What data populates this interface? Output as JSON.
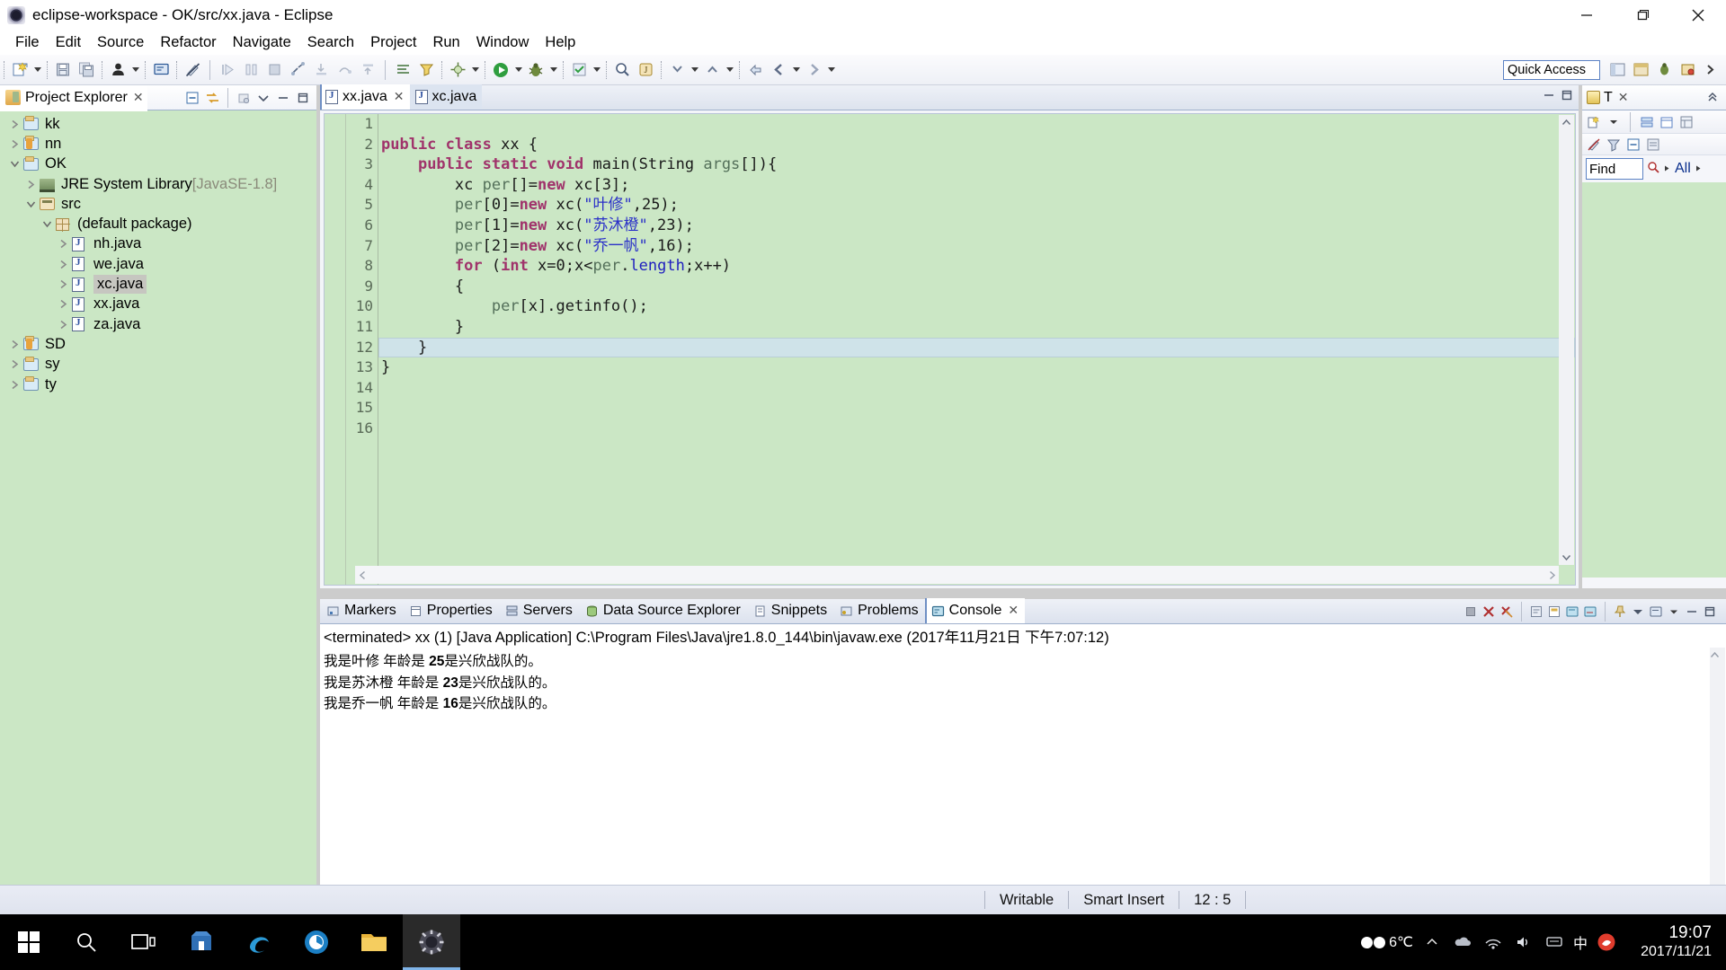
{
  "window": {
    "title": "eclipse-workspace - OK/src/xx.java - Eclipse",
    "app_icon": "eclipse-icon",
    "minimize_label": "minimize-icon",
    "maximize_label": "maximize-icon",
    "close_label": "close-icon"
  },
  "menubar": {
    "items": [
      {
        "label": "File"
      },
      {
        "label": "Edit"
      },
      {
        "label": "Source"
      },
      {
        "label": "Refactor"
      },
      {
        "label": "Navigate"
      },
      {
        "label": "Search"
      },
      {
        "label": "Project"
      },
      {
        "label": "Run"
      },
      {
        "label": "Window"
      },
      {
        "label": "Help"
      }
    ]
  },
  "toolbar": {
    "quick_access_value": "Quick Access",
    "quick_access_placeholder": "Quick Access"
  },
  "project_explorer": {
    "tab_label": "Project Explorer",
    "close_label": "✕",
    "tree": [
      {
        "label": "kk",
        "indent": 0,
        "twisty": "collapsed",
        "icon": "project-folder-icon",
        "dim": "",
        "selected": false
      },
      {
        "label": "nn",
        "indent": 0,
        "twisty": "collapsed",
        "icon": "project-warn-icon",
        "dim": "",
        "selected": false
      },
      {
        "label": "OK",
        "indent": 0,
        "twisty": "expanded",
        "icon": "project-folder-icon",
        "dim": "",
        "selected": false
      },
      {
        "label": "JRE System Library",
        "indent": 1,
        "twisty": "collapsed",
        "icon": "library-icon",
        "dim": " [JavaSE-1.8]",
        "selected": false
      },
      {
        "label": "src",
        "indent": 1,
        "twisty": "expanded",
        "icon": "source-folder-icon",
        "dim": "",
        "selected": false
      },
      {
        "label": "(default package)",
        "indent": 2,
        "twisty": "expanded",
        "icon": "package-icon",
        "dim": "",
        "selected": false
      },
      {
        "label": "nh.java",
        "indent": 3,
        "twisty": "collapsed",
        "icon": "java-file-icon",
        "dim": "",
        "selected": false
      },
      {
        "label": "we.java",
        "indent": 3,
        "twisty": "collapsed",
        "icon": "java-file-icon",
        "dim": "",
        "selected": false
      },
      {
        "label": "xc.java",
        "indent": 3,
        "twisty": "collapsed",
        "icon": "java-file-icon",
        "dim": "",
        "selected": true
      },
      {
        "label": "xx.java",
        "indent": 3,
        "twisty": "collapsed",
        "icon": "java-file-icon",
        "dim": "",
        "selected": false
      },
      {
        "label": "za.java",
        "indent": 3,
        "twisty": "collapsed",
        "icon": "java-file-icon",
        "dim": "",
        "selected": false
      },
      {
        "label": "SD",
        "indent": 0,
        "twisty": "collapsed",
        "icon": "project-warn-icon",
        "dim": "",
        "selected": false
      },
      {
        "label": "sy",
        "indent": 0,
        "twisty": "collapsed",
        "icon": "project-folder-icon",
        "dim": "",
        "selected": false
      },
      {
        "label": "ty",
        "indent": 0,
        "twisty": "collapsed",
        "icon": "project-folder-icon",
        "dim": "",
        "selected": false
      }
    ]
  },
  "editor": {
    "tabs": [
      {
        "label": "xx.java",
        "active": true,
        "close_label": "✕"
      },
      {
        "label": "xc.java",
        "active": false,
        "close_label": ""
      }
    ],
    "current_line": 12,
    "total_gutter_lines": 16,
    "line_numbers": [
      1,
      2,
      3,
      4,
      5,
      6,
      7,
      8,
      9,
      10,
      11,
      12,
      13,
      14,
      15,
      16
    ],
    "code_lines": [
      {
        "n": 1,
        "text": ""
      },
      {
        "n": 2,
        "text": "public class xx {"
      },
      {
        "n": 3,
        "text": "    public static void main(String args[]){"
      },
      {
        "n": 4,
        "text": "        xc per[]=new xc[3];"
      },
      {
        "n": 5,
        "text": "        per[0]=new xc(\"叶修\",25);"
      },
      {
        "n": 6,
        "text": "        per[1]=new xc(\"苏沐橙\",23);"
      },
      {
        "n": 7,
        "text": "        per[2]=new xc(\"乔一帆\",16);"
      },
      {
        "n": 8,
        "text": "        for (int x=0;x<per.length;x++)"
      },
      {
        "n": 9,
        "text": "        {"
      },
      {
        "n": 10,
        "text": "            per[x].getinfo();"
      },
      {
        "n": 11,
        "text": "        }"
      },
      {
        "n": 12,
        "text": "    }"
      },
      {
        "n": 13,
        "text": "}"
      },
      {
        "n": 14,
        "text": ""
      },
      {
        "n": 15,
        "text": ""
      },
      {
        "n": 16,
        "text": ""
      }
    ]
  },
  "task_list": {
    "tab_label": "T",
    "close_label": "✕",
    "find_value": "Find",
    "find_placeholder": "Find",
    "all_label": "All"
  },
  "bottom_panel": {
    "tabs": [
      {
        "label": "Markers",
        "icon": "markers-icon",
        "active": false,
        "close_label": ""
      },
      {
        "label": "Properties",
        "icon": "properties-icon",
        "active": false,
        "close_label": ""
      },
      {
        "label": "Servers",
        "icon": "servers-icon",
        "active": false,
        "close_label": ""
      },
      {
        "label": "Data Source Explorer",
        "icon": "datasource-icon",
        "active": false,
        "close_label": ""
      },
      {
        "label": "Snippets",
        "icon": "snippets-icon",
        "active": false,
        "close_label": ""
      },
      {
        "label": "Problems",
        "icon": "problems-icon",
        "active": false,
        "close_label": ""
      },
      {
        "label": "Console",
        "icon": "console-icon",
        "active": true,
        "close_label": "✕"
      }
    ],
    "process_header": "<terminated> xx (1) [Java Application] C:\\Program Files\\Java\\jre1.8.0_144\\bin\\javaw.exe (2017年11月21日 下午7:07:12)",
    "output_lines": [
      {
        "pre": "我是叶修 年龄是 ",
        "num": "25",
        "post": "是兴欣战队的。"
      },
      {
        "pre": "我是苏沐橙 年龄是 ",
        "num": "23",
        "post": "是兴欣战队的。"
      },
      {
        "pre": "我是乔一帆 年龄是 ",
        "num": "16",
        "post": "是兴欣战队的。"
      }
    ]
  },
  "statusbar": {
    "writable": "Writable",
    "insert_mode": "Smart Insert",
    "cursor_position": "12 : 5"
  },
  "taskbar": {
    "start_label": "start-icon",
    "items": [
      {
        "name": "start-button",
        "icon": "windows-logo-icon",
        "active": false
      },
      {
        "name": "search-button",
        "icon": "search-icon",
        "active": false
      },
      {
        "name": "task-view-button",
        "icon": "task-view-icon",
        "active": false
      },
      {
        "name": "store-button",
        "icon": "microsoft-store-icon",
        "active": false
      },
      {
        "name": "edge-button",
        "icon": "edge-browser-icon",
        "active": false
      },
      {
        "name": "browser-button",
        "icon": "qq-browser-icon",
        "active": false
      },
      {
        "name": "explorer-button",
        "icon": "file-explorer-icon",
        "active": false
      },
      {
        "name": "eclipse-button",
        "icon": "eclipse-icon",
        "active": true
      }
    ],
    "tray": {
      "weather_temp": "6℃",
      "weather_icon": "cloudy-icon",
      "chevron_icon": "chevron-up-icon",
      "ime_label": "中",
      "time": "19:07",
      "date": "2017/11/21"
    }
  },
  "colors": {
    "editor_background": "#cbe7c5",
    "tree_background": "#cbe7c5",
    "keyword": "#a0336b",
    "string": "#2a30c8",
    "field": "#1f1fbf",
    "accent": "#6f8fc4",
    "taskbar": "#000000"
  }
}
